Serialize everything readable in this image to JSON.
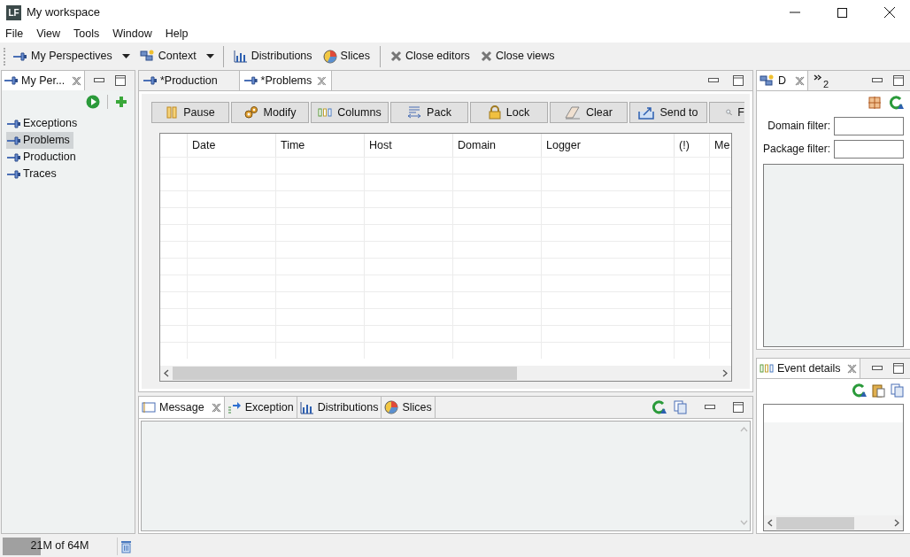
{
  "window": {
    "title": "My workspace",
    "logo": "LF"
  },
  "menu": [
    "File",
    "View",
    "Tools",
    "Window",
    "Help"
  ],
  "toolbar": [
    {
      "label": "My Perspectives",
      "dropdown": true
    },
    {
      "label": "Context",
      "dropdown": true
    },
    {
      "label": "Distributions",
      "dropdown": false
    },
    {
      "label": "Slices",
      "dropdown": false
    },
    {
      "label": "Close editors",
      "dropdown": false
    },
    {
      "label": "Close views",
      "dropdown": false
    }
  ],
  "perspectives_view": {
    "title": "My Per...",
    "items": [
      {
        "label": "Exceptions",
        "selected": false
      },
      {
        "label": "Problems",
        "selected": true
      },
      {
        "label": "Production",
        "selected": false
      },
      {
        "label": "Traces",
        "selected": false
      }
    ]
  },
  "editor_tabs": [
    {
      "label": "*Production",
      "selected": false
    },
    {
      "label": "*Problems",
      "selected": true
    }
  ],
  "editor_buttons": [
    "Pause",
    "Modify",
    "Columns",
    "Pack",
    "Lock",
    "Clear",
    "Send to",
    "F"
  ],
  "table": {
    "columns": [
      "",
      "Date",
      "Time",
      "Host",
      "Domain",
      "Logger",
      "(!)",
      "Me"
    ]
  },
  "bottom_tabs": [
    {
      "label": "Message",
      "selected": true
    },
    {
      "label": "Exception",
      "selected": false
    },
    {
      "label": "Distributions",
      "selected": false
    },
    {
      "label": "Slices",
      "selected": false
    }
  ],
  "domains_view": {
    "tabs": [
      {
        "label": "D",
        "selected": true
      },
      {
        "label": "2",
        "selected": false
      }
    ],
    "domain_filter": "Domain filter:",
    "package_filter": "Package filter:"
  },
  "event_details": {
    "title": "Event details"
  },
  "status_bar": {
    "memory": "21M of 64M",
    "level": 0.33
  }
}
